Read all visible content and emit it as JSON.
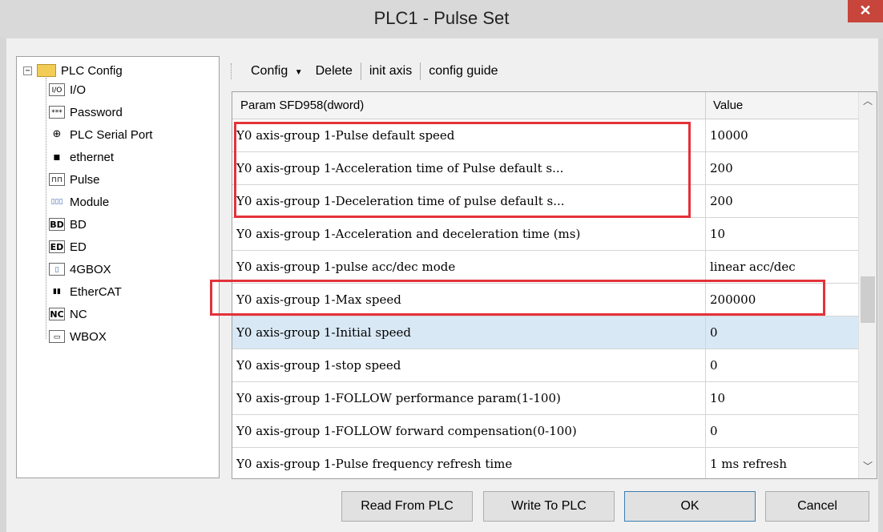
{
  "window": {
    "title": "PLC1 - Pulse  Set",
    "close_label": "✕"
  },
  "tree": {
    "root": "PLC Config",
    "items": [
      {
        "label": "I/O",
        "icon": "I/O"
      },
      {
        "label": "Password",
        "icon": "***"
      },
      {
        "label": "PLC Serial Port",
        "icon": "⊕"
      },
      {
        "label": "ethernet",
        "icon": "▪"
      },
      {
        "label": "Pulse",
        "icon": "⊓⊓"
      },
      {
        "label": "Module",
        "icon": "▯▯▯"
      },
      {
        "label": "BD",
        "icon": "BD"
      },
      {
        "label": "ED",
        "icon": "ED"
      },
      {
        "label": "4GBOX",
        "icon": "▯"
      },
      {
        "label": "EtherCAT",
        "icon": "▮▮"
      },
      {
        "label": "NC",
        "icon": "NC"
      },
      {
        "label": "WBOX",
        "icon": "▭"
      }
    ]
  },
  "toolbar": {
    "config": "Config",
    "delete": "Delete",
    "init_axis": "init axis",
    "config_guide": "config guide"
  },
  "grid": {
    "header_param": "Param SFD958(dword)",
    "header_value": "Value",
    "rows": [
      {
        "param": "Y0 axis-group 1-Pulse default speed",
        "value": "10000"
      },
      {
        "param": "Y0 axis-group 1-Acceleration time of Pulse default s...",
        "value": "200"
      },
      {
        "param": "Y0 axis-group 1-Deceleration time of pulse default s...",
        "value": "200"
      },
      {
        "param": "Y0 axis-group 1-Acceleration and deceleration time (ms)",
        "value": "10"
      },
      {
        "param": "Y0 axis-group 1-pulse acc/dec mode",
        "value": "linear acc/dec"
      },
      {
        "param": "Y0 axis-group 1-Max speed",
        "value": "200000"
      },
      {
        "param": "Y0 axis-group 1-Initial speed",
        "value": "0"
      },
      {
        "param": "Y0 axis-group 1-stop speed",
        "value": "0"
      },
      {
        "param": "Y0 axis-group 1-FOLLOW performance param(1-100)",
        "value": "10"
      },
      {
        "param": "Y0 axis-group 1-FOLLOW forward compensation(0-100)",
        "value": "0"
      },
      {
        "param": "Y0 axis-group 1-Pulse frequency refresh time",
        "value": "1 ms refresh"
      }
    ]
  },
  "buttons": {
    "read": "Read From PLC",
    "write": "Write To PLC",
    "ok": "OK",
    "cancel": "Cancel"
  },
  "colors": {
    "highlight": "#e3323a",
    "selected_row": "#d9e8f5",
    "close": "#c7453a"
  }
}
